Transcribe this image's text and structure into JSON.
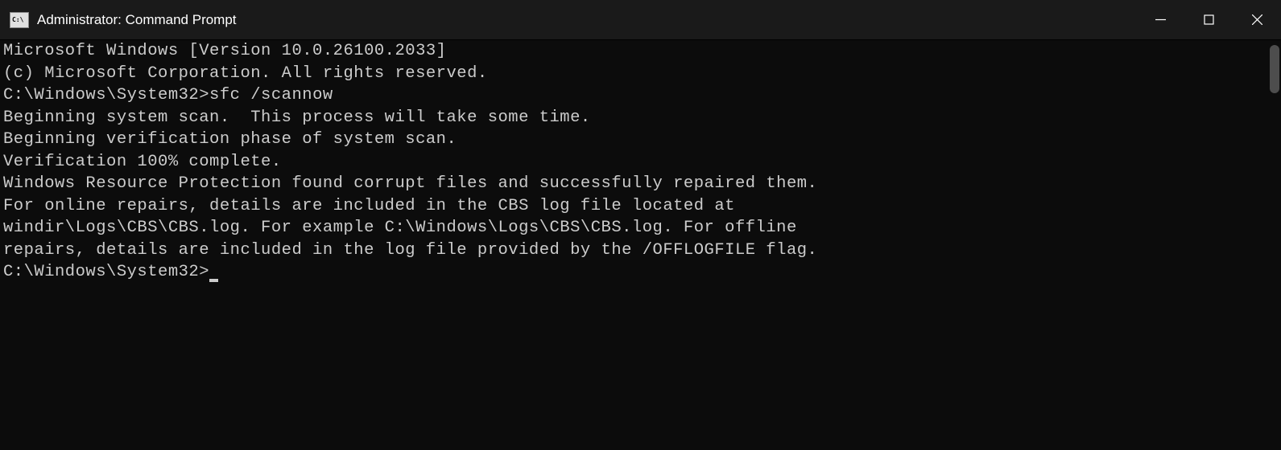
{
  "window": {
    "title": "Administrator: Command Prompt"
  },
  "terminal": {
    "line1": "Microsoft Windows [Version 10.0.26100.2033]",
    "line2": "(c) Microsoft Corporation. All rights reserved.",
    "blank1": "",
    "prompt1": "C:\\Windows\\System32>",
    "command1": "sfc /scannow",
    "blank2": "",
    "line3": "Beginning system scan.  This process will take some time.",
    "blank3": "",
    "line4": "Beginning verification phase of system scan.",
    "line5": "Verification 100% complete.",
    "blank4": "",
    "line6": "Windows Resource Protection found corrupt files and successfully repaired them.",
    "line7": "For online repairs, details are included in the CBS log file located at",
    "line8": "windir\\Logs\\CBS\\CBS.log. For example C:\\Windows\\Logs\\CBS\\CBS.log. For offline",
    "line9": "repairs, details are included in the log file provided by the /OFFLOGFILE flag.",
    "blank5": "",
    "prompt2": "C:\\Windows\\System32>"
  }
}
